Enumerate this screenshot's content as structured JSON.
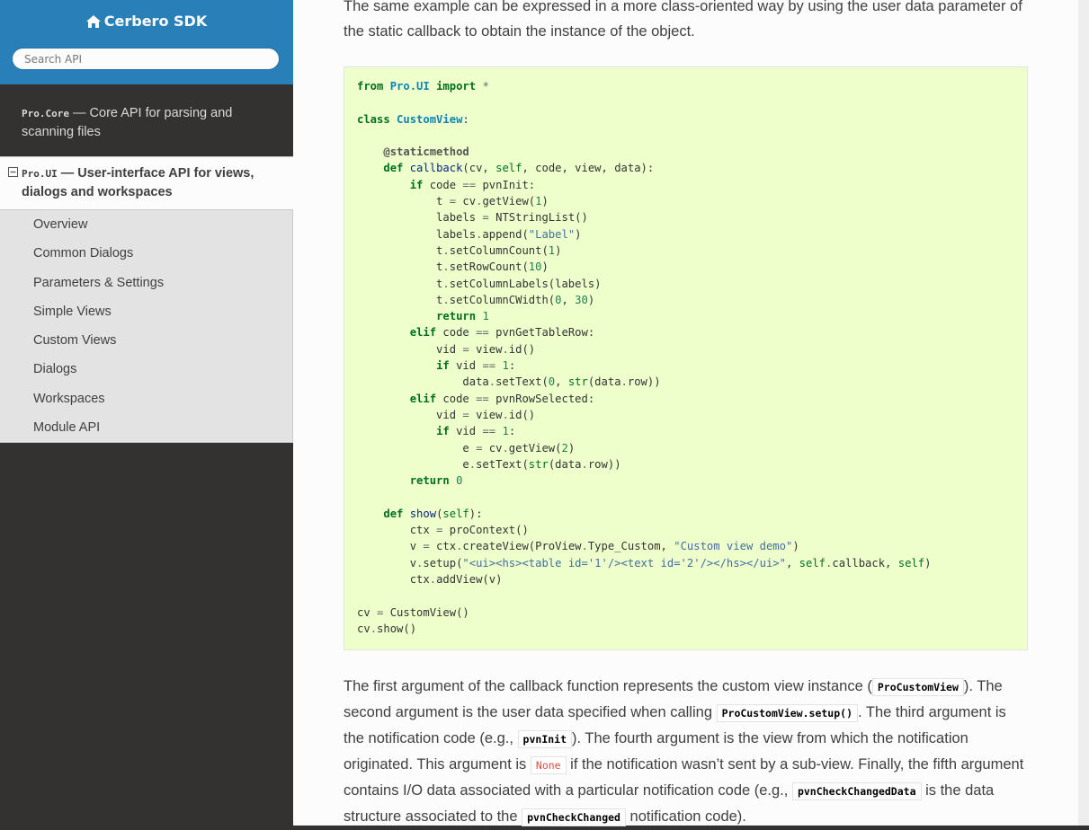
{
  "sidebar": {
    "brand": "Cerbero SDK",
    "search_placeholder": "Search API",
    "items": [
      {
        "code": "Pro.Core",
        "label": " — Core API for parsing and scanning files"
      },
      {
        "code": "Pro.UI",
        "label": " — User-interface API for views, dialogs and workspaces"
      }
    ],
    "sub_items": [
      "Overview",
      "Common Dialogs",
      "Parameters & Settings",
      "Simple Views",
      "Custom Views",
      "Dialogs",
      "Workspaces",
      "Module API"
    ]
  },
  "content": {
    "intro": "The same example can be expressed in a more class-oriented way by using the user data parameter of the static callback to obtain the instance of the object.",
    "code": [
      [
        [
          "k",
          "from"
        ],
        [
          "t",
          " "
        ],
        [
          "nn",
          "Pro.UI"
        ],
        [
          "t",
          " "
        ],
        [
          "k",
          "import"
        ],
        [
          "t",
          " "
        ],
        [
          "o",
          "*"
        ]
      ],
      [],
      [
        [
          "k",
          "class"
        ],
        [
          "t",
          " "
        ],
        [
          "nc",
          "CustomView"
        ],
        [
          "t",
          ":"
        ]
      ],
      [],
      [
        [
          "t",
          "    "
        ],
        [
          "nd",
          "@staticmethod"
        ]
      ],
      [
        [
          "t",
          "    "
        ],
        [
          "k",
          "def"
        ],
        [
          "t",
          " "
        ],
        [
          "nf",
          "callback"
        ],
        [
          "t",
          "(cv, "
        ],
        [
          "bp",
          "self"
        ],
        [
          "t",
          ", code, view, data):"
        ]
      ],
      [
        [
          "t",
          "        "
        ],
        [
          "k",
          "if"
        ],
        [
          "t",
          " code "
        ],
        [
          "o",
          "=="
        ],
        [
          "t",
          " pvnInit:"
        ]
      ],
      [
        [
          "t",
          "            t "
        ],
        [
          "o",
          "="
        ],
        [
          "t",
          " cv"
        ],
        [
          "o",
          "."
        ],
        [
          "t",
          "getView("
        ],
        [
          "m",
          "1"
        ],
        [
          "t",
          ")"
        ]
      ],
      [
        [
          "t",
          "            labels "
        ],
        [
          "o",
          "="
        ],
        [
          "t",
          " NTStringList()"
        ]
      ],
      [
        [
          "t",
          "            labels"
        ],
        [
          "o",
          "."
        ],
        [
          "t",
          "append("
        ],
        [
          "s",
          "\"Label\""
        ],
        [
          "t",
          ")"
        ]
      ],
      [
        [
          "t",
          "            t"
        ],
        [
          "o",
          "."
        ],
        [
          "t",
          "setColumnCount("
        ],
        [
          "m",
          "1"
        ],
        [
          "t",
          ")"
        ]
      ],
      [
        [
          "t",
          "            t"
        ],
        [
          "o",
          "."
        ],
        [
          "t",
          "setRowCount("
        ],
        [
          "m",
          "10"
        ],
        [
          "t",
          ")"
        ]
      ],
      [
        [
          "t",
          "            t"
        ],
        [
          "o",
          "."
        ],
        [
          "t",
          "setColumnLabels(labels)"
        ]
      ],
      [
        [
          "t",
          "            t"
        ],
        [
          "o",
          "."
        ],
        [
          "t",
          "setColumnCWidth("
        ],
        [
          "m",
          "0"
        ],
        [
          "t",
          ", "
        ],
        [
          "m",
          "30"
        ],
        [
          "t",
          ")"
        ]
      ],
      [
        [
          "t",
          "            "
        ],
        [
          "k",
          "return"
        ],
        [
          "t",
          " "
        ],
        [
          "m",
          "1"
        ]
      ],
      [
        [
          "t",
          "        "
        ],
        [
          "k",
          "elif"
        ],
        [
          "t",
          " code "
        ],
        [
          "o",
          "=="
        ],
        [
          "t",
          " pvnGetTableRow:"
        ]
      ],
      [
        [
          "t",
          "            vid "
        ],
        [
          "o",
          "="
        ],
        [
          "t",
          " view"
        ],
        [
          "o",
          "."
        ],
        [
          "t",
          "id()"
        ]
      ],
      [
        [
          "t",
          "            "
        ],
        [
          "k",
          "if"
        ],
        [
          "t",
          " vid "
        ],
        [
          "o",
          "=="
        ],
        [
          "t",
          " "
        ],
        [
          "m",
          "1"
        ],
        [
          "t",
          ":"
        ]
      ],
      [
        [
          "t",
          "                data"
        ],
        [
          "o",
          "."
        ],
        [
          "t",
          "setText("
        ],
        [
          "m",
          "0"
        ],
        [
          "t",
          ", "
        ],
        [
          "nb",
          "str"
        ],
        [
          "t",
          "(data"
        ],
        [
          "o",
          "."
        ],
        [
          "t",
          "row))"
        ]
      ],
      [
        [
          "t",
          "        "
        ],
        [
          "k",
          "elif"
        ],
        [
          "t",
          " code "
        ],
        [
          "o",
          "=="
        ],
        [
          "t",
          " pvnRowSelected:"
        ]
      ],
      [
        [
          "t",
          "            vid "
        ],
        [
          "o",
          "="
        ],
        [
          "t",
          " view"
        ],
        [
          "o",
          "."
        ],
        [
          "t",
          "id()"
        ]
      ],
      [
        [
          "t",
          "            "
        ],
        [
          "k",
          "if"
        ],
        [
          "t",
          " vid "
        ],
        [
          "o",
          "=="
        ],
        [
          "t",
          " "
        ],
        [
          "m",
          "1"
        ],
        [
          "t",
          ":"
        ]
      ],
      [
        [
          "t",
          "                e "
        ],
        [
          "o",
          "="
        ],
        [
          "t",
          " cv"
        ],
        [
          "o",
          "."
        ],
        [
          "t",
          "getView("
        ],
        [
          "m",
          "2"
        ],
        [
          "t",
          ")"
        ]
      ],
      [
        [
          "t",
          "                e"
        ],
        [
          "o",
          "."
        ],
        [
          "t",
          "setText("
        ],
        [
          "nb",
          "str"
        ],
        [
          "t",
          "(data"
        ],
        [
          "o",
          "."
        ],
        [
          "t",
          "row))"
        ]
      ],
      [
        [
          "t",
          "        "
        ],
        [
          "k",
          "return"
        ],
        [
          "t",
          " "
        ],
        [
          "m",
          "0"
        ]
      ],
      [],
      [
        [
          "t",
          "    "
        ],
        [
          "k",
          "def"
        ],
        [
          "t",
          " "
        ],
        [
          "nf",
          "show"
        ],
        [
          "t",
          "("
        ],
        [
          "bp",
          "self"
        ],
        [
          "t",
          "):"
        ]
      ],
      [
        [
          "t",
          "        ctx "
        ],
        [
          "o",
          "="
        ],
        [
          "t",
          " proContext()"
        ]
      ],
      [
        [
          "t",
          "        v "
        ],
        [
          "o",
          "="
        ],
        [
          "t",
          " ctx"
        ],
        [
          "o",
          "."
        ],
        [
          "t",
          "createView(ProView"
        ],
        [
          "o",
          "."
        ],
        [
          "t",
          "Type_Custom, "
        ],
        [
          "s",
          "\"Custom view demo\""
        ],
        [
          "t",
          ")"
        ]
      ],
      [
        [
          "t",
          "        v"
        ],
        [
          "o",
          "."
        ],
        [
          "t",
          "setup("
        ],
        [
          "s",
          "\"<ui><hs><table id='1'/><text id='2'/></hs></ui>\""
        ],
        [
          "t",
          ", "
        ],
        [
          "bp",
          "self"
        ],
        [
          "o",
          "."
        ],
        [
          "t",
          "callback, "
        ],
        [
          "bp",
          "self"
        ],
        [
          "t",
          ")"
        ]
      ],
      [
        [
          "t",
          "        ctx"
        ],
        [
          "o",
          "."
        ],
        [
          "t",
          "addView(v)"
        ]
      ],
      [],
      [
        [
          "t",
          "cv "
        ],
        [
          "o",
          "="
        ],
        [
          "t",
          " CustomView()"
        ]
      ],
      [
        [
          "t",
          "cv"
        ],
        [
          "o",
          "."
        ],
        [
          "t",
          "show()"
        ]
      ]
    ],
    "explanation": [
      {
        "t": "The first argument of the callback function represents the custom view instance ("
      },
      {
        "c": "ProCustomView"
      },
      {
        "t": "). The second argument is the user data specified when calling "
      },
      {
        "c": "ProCustomView.setup()"
      },
      {
        "t": ". The third argument is the notification code (e.g., "
      },
      {
        "c": "pvnInit"
      },
      {
        "t": "). The fourth argument is the view from which the notification originated. This argument is "
      },
      {
        "c": "None",
        "none": true
      },
      {
        "t": " if the notification wasn’t sent by a sub-view. Finally, the fifth argument contains I/O data associated with a particular notification code (e.g., "
      },
      {
        "c": "pvnCheckChangedData"
      },
      {
        "t": " is the data structure associated to the "
      },
      {
        "c": "pvnCheckChanged"
      },
      {
        "t": " notification code)."
      }
    ]
  }
}
